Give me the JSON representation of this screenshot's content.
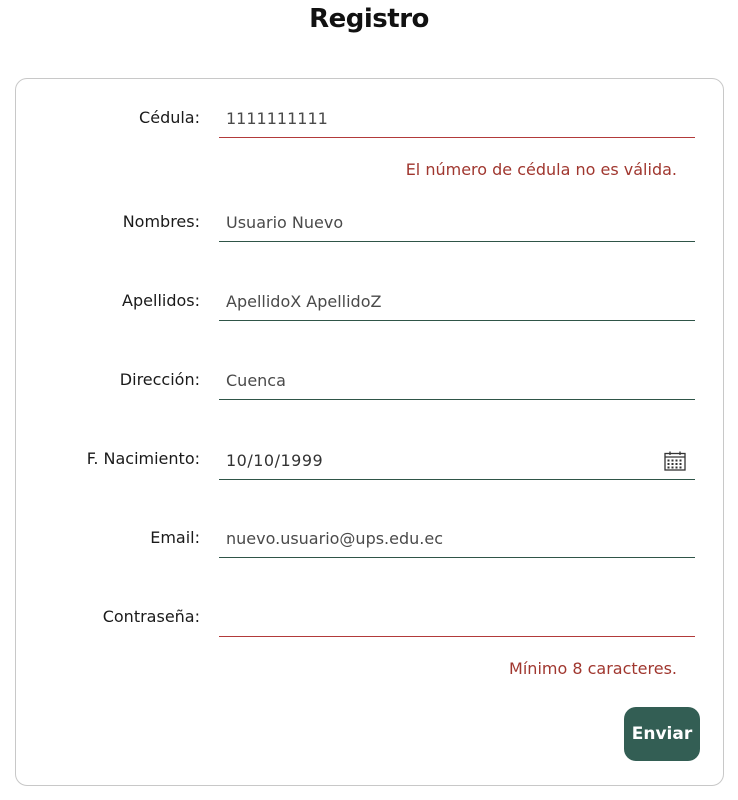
{
  "page": {
    "title": "Registro"
  },
  "form": {
    "fields": [
      {
        "label": "Cédula:",
        "value": "1111111111",
        "error": "El número de cédula no es válida."
      },
      {
        "label": "Nombres:",
        "value": "Usuario Nuevo"
      },
      {
        "label": "Apellidos:",
        "value": "ApellidoX ApellidoZ"
      },
      {
        "label": "Dirección:",
        "value": "Cuenca"
      },
      {
        "label": "F. Nacimiento:",
        "value": "10/10/1999",
        "icon": "calendar-icon"
      },
      {
        "label": "Email:",
        "value": "nuevo.usuario@ups.edu.ec"
      },
      {
        "label": "Contraseña:",
        "value": "",
        "error": "Mínimo 8 caracteres."
      }
    ],
    "submit_label": "Enviar"
  },
  "colors": {
    "accent": "#335e54",
    "underline_ok": "#2f5548",
    "underline_error": "#b23a3a",
    "error_text": "#a0372f"
  }
}
